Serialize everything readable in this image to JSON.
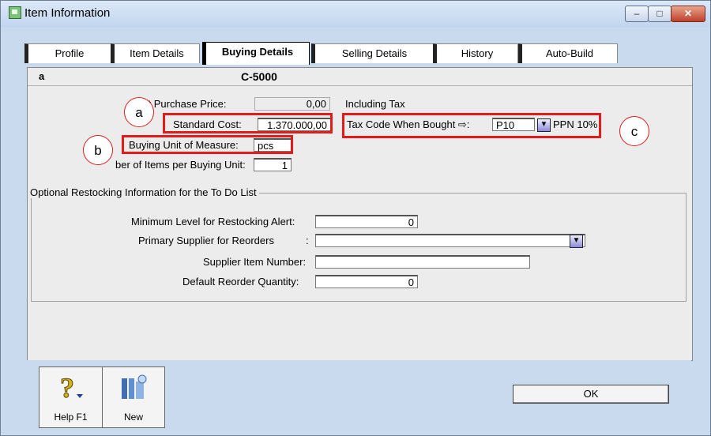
{
  "window": {
    "title": "Item Information",
    "controls": {
      "minimize": "–",
      "maximize": "□",
      "close": "✕"
    }
  },
  "tabs": [
    {
      "label": "Profile"
    },
    {
      "label": "Item Details"
    },
    {
      "label": "Buying Details",
      "active": true
    },
    {
      "label": "Selling Details"
    },
    {
      "label": "History"
    },
    {
      "label": "Auto-Build"
    }
  ],
  "header": {
    "item_name": "a",
    "item_code": "C-5000"
  },
  "buying": {
    "last_purchase_price_label": "st Purchase Price:",
    "last_purchase_price_value": "0,00",
    "including_tax": "Including Tax",
    "standard_cost_label": "Standard Cost:",
    "standard_cost_value": "1.370.000,00",
    "tax_code_label": "Tax Code When Bought ⇨:",
    "tax_code_value": "P10",
    "tax_desc": "PPN 10%",
    "buying_unit_label": "Buying Unit of Measure:",
    "buying_unit_value": "pcs",
    "items_per_unit_label": "ber of Items per Buying Unit:",
    "items_per_unit_value": "1"
  },
  "restock": {
    "group_title": "Optional Restocking Information for the To Do List",
    "min_level_label": "Minimum Level for Restocking Alert:",
    "min_level_value": "0",
    "primary_supplier_label": "Primary Supplier for Reorders",
    "primary_supplier_colon": ":",
    "primary_supplier_value": "",
    "supplier_item_label": "Supplier Item Number:",
    "supplier_item_value": "",
    "reorder_qty_label": "Default Reorder Quantity:",
    "reorder_qty_value": "0"
  },
  "callouts": {
    "a": "a",
    "b": "b",
    "c": "c"
  },
  "footer": {
    "help_label": "Help F1",
    "new_label": "New",
    "ok_label": "OK"
  },
  "colors": {
    "highlight": "#e31b1b",
    "window_bg": "#c9d9ee",
    "panel_bg": "#ececec"
  }
}
